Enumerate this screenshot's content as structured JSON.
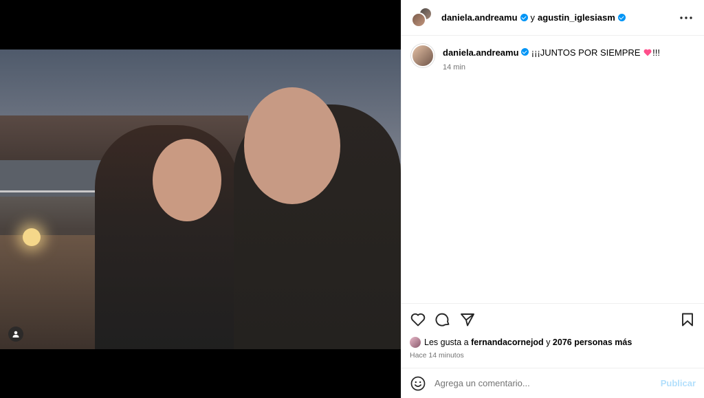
{
  "post": {
    "author": "daniela.andreamu",
    "connector": "y",
    "collaborator": "agustin_iglesiasm"
  },
  "caption": {
    "user": "daniela.andreamu",
    "text_before": "¡¡¡JUNTOS POR SIEMPRE",
    "text_after": "!!!",
    "emoji": "heart-icon",
    "time": "14 min"
  },
  "likes": {
    "prefix": "Les gusta a",
    "user": "fernandacornejod",
    "middle": "y",
    "count": "2076 personas más"
  },
  "posted_ago": "Hace 14 minutos",
  "comment": {
    "placeholder": "Agrega un comentario...",
    "publish_label": "Publicar"
  },
  "colors": {
    "verified": "#0095f6",
    "publish_disabled": "#b2dffc",
    "heart_emoji": "#ff4f8b"
  },
  "icons": [
    "user-tag-icon",
    "more-options-icon",
    "like-icon",
    "comment-icon",
    "share-icon",
    "save-icon",
    "emoji-icon",
    "verified-icon"
  ]
}
